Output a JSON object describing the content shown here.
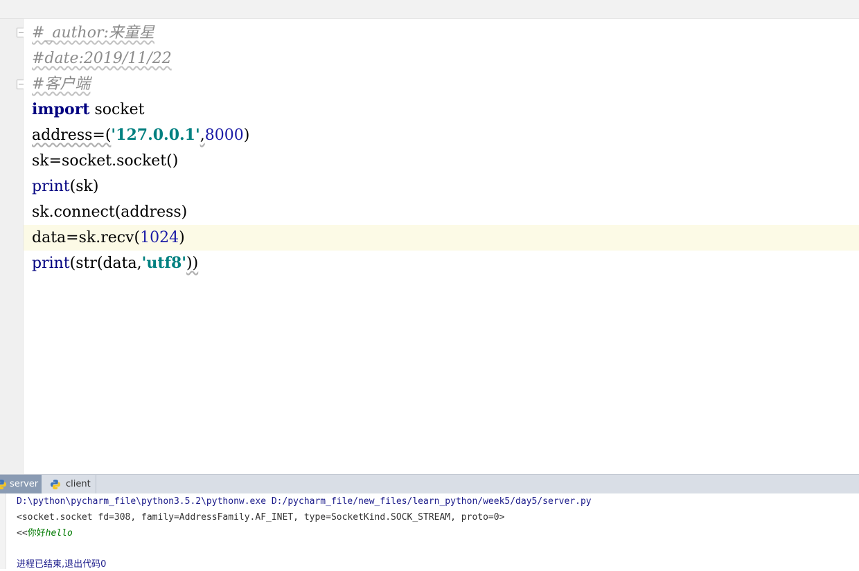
{
  "editor": {
    "lines": {
      "l1": "#_author:来童星",
      "l2": "#date:2019/11/22",
      "l3": "#客户端",
      "l4_kw": "import",
      "l4_rest": " socket",
      "l5_a": "address=(",
      "l5_str": "'127.0.0.1'",
      "l5_comma": ",",
      "l5_num": "8000",
      "l5_close": ")",
      "l6": "sk=socket.socket()",
      "l7_fn": "print",
      "l7_rest": "(sk)",
      "l8": "sk.connect(address)",
      "l9_a": "data=sk.recv(",
      "l9_num": "1024",
      "l9_close": ")",
      "l10_fn": "print",
      "l10_a": "(str(data,",
      "l10_str": "'utf8'",
      "l10_close": "))"
    }
  },
  "run_tabs": [
    {
      "label": "server",
      "active": true
    },
    {
      "label": "client",
      "active": false
    }
  ],
  "console": {
    "cmd": "D:\\python\\pycharm_file\\python3.5.2\\pythonw.exe D:/pycharm_file/new_files/learn_python/week5/day5/server.py",
    "out1": "<socket.socket fd=308, family=AddressFamily.AF_INET, type=SocketKind.SOCK_STREAM, proto=0>",
    "out2_prefix": "<<",
    "out2_cn": "你好",
    "out2_en": "hello",
    "exit": "进程已结束,退出代码0"
  },
  "colors": {
    "keyword": "#000080",
    "string": "#008080",
    "number": "#1a1aa6",
    "comment": "#8c8c8c",
    "active_line": "#fcfae6",
    "active_tab": "#8a9bb3"
  }
}
